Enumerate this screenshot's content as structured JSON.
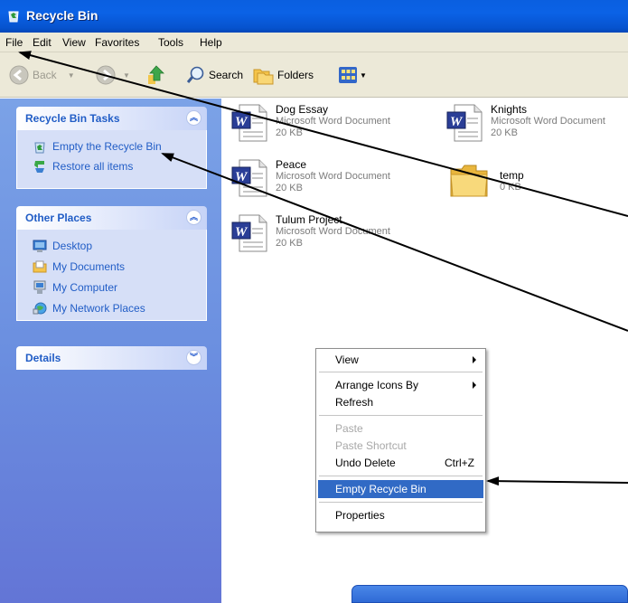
{
  "window": {
    "title": "Recycle Bin"
  },
  "menu": [
    "File",
    "Edit",
    "View",
    "Favorites",
    "Tools",
    "Help"
  ],
  "toolbar": {
    "back": "Back",
    "search": "Search",
    "folders": "Folders"
  },
  "tasks_panel": {
    "title": "Recycle Bin Tasks",
    "items": [
      {
        "label": "Empty the Recycle Bin",
        "icon": "empty-recycle-bin-icon"
      },
      {
        "label": "Restore all items",
        "icon": "restore-icon"
      }
    ]
  },
  "other_places": {
    "title": "Other Places",
    "items": [
      {
        "label": "Desktop",
        "icon": "desktop-icon"
      },
      {
        "label": "My Documents",
        "icon": "my-documents-icon"
      },
      {
        "label": "My Computer",
        "icon": "my-computer-icon"
      },
      {
        "label": "My Network Places",
        "icon": "network-places-icon"
      }
    ]
  },
  "details_panel": {
    "title": "Details"
  },
  "files": [
    {
      "name": "Dog Essay",
      "type": "Microsoft Word Document",
      "size": "20 KB",
      "icon": "word-document-icon"
    },
    {
      "name": "Knights",
      "type": "Microsoft Word Document",
      "size": "20 KB",
      "icon": "word-document-icon"
    },
    {
      "name": "Peace",
      "type": "Microsoft Word Document",
      "size": "20 KB",
      "icon": "word-document-icon"
    },
    {
      "name": "temp",
      "type": "",
      "size": "0 KB",
      "icon": "folder-icon"
    },
    {
      "name": "Tulum Project",
      "type": "Microsoft Word Document",
      "size": "20 KB",
      "icon": "word-document-icon"
    }
  ],
  "context_menu": {
    "items": [
      {
        "label": "View",
        "submenu": true,
        "enabled": true
      },
      {
        "label": "Arrange Icons By",
        "submenu": true,
        "enabled": true
      },
      {
        "label": "Refresh",
        "enabled": true
      },
      {
        "label": "Paste",
        "enabled": false
      },
      {
        "label": "Paste Shortcut",
        "enabled": false
      },
      {
        "label": "Undo Delete",
        "shortcut": "Ctrl+Z",
        "enabled": true
      },
      {
        "label": "Empty Recycle Bin",
        "enabled": true,
        "highlighted": true
      },
      {
        "label": "Properties",
        "enabled": true
      }
    ]
  },
  "colors": {
    "titlebar": "#0a5fe0",
    "taskpane": "#6b8fe0",
    "link": "#215dc6",
    "highlight": "#316ac5"
  }
}
